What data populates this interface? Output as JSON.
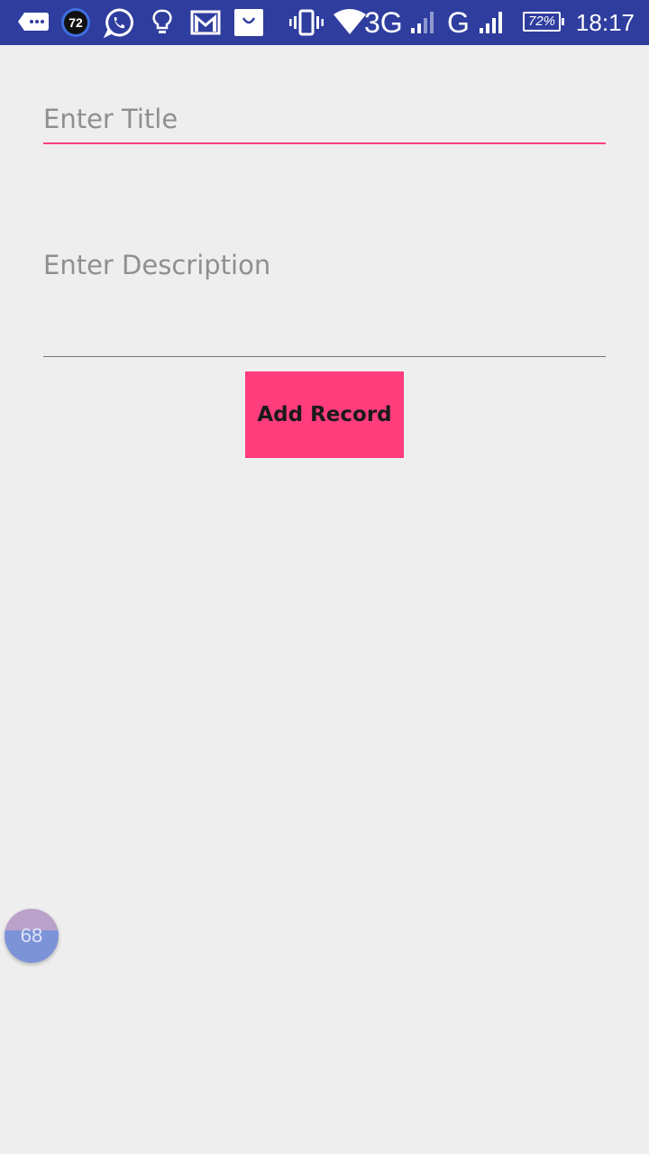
{
  "status_bar": {
    "badge_count": "72",
    "network_3g": "3G",
    "network_g": "G",
    "battery_percent": "72%",
    "battery_level": 0.72,
    "time": "18:17",
    "icons": [
      "chat-bubble-icon",
      "badge-72-icon",
      "whatsapp-icon",
      "lightbulb-icon",
      "gmail-icon",
      "shopping-bag-icon",
      "vibrate-icon",
      "wifi-icon",
      "signal-icon",
      "signal-icon",
      "battery-icon"
    ],
    "color": "#2f3d9e"
  },
  "form": {
    "title_placeholder": "Enter Title",
    "title_value": "",
    "description_placeholder": "Enter Description",
    "description_value": "",
    "add_button_label": "Add Record",
    "accent_color": "#ff4081",
    "button_color": "#ff3d7d"
  },
  "floating_bubble": {
    "value": "68"
  }
}
